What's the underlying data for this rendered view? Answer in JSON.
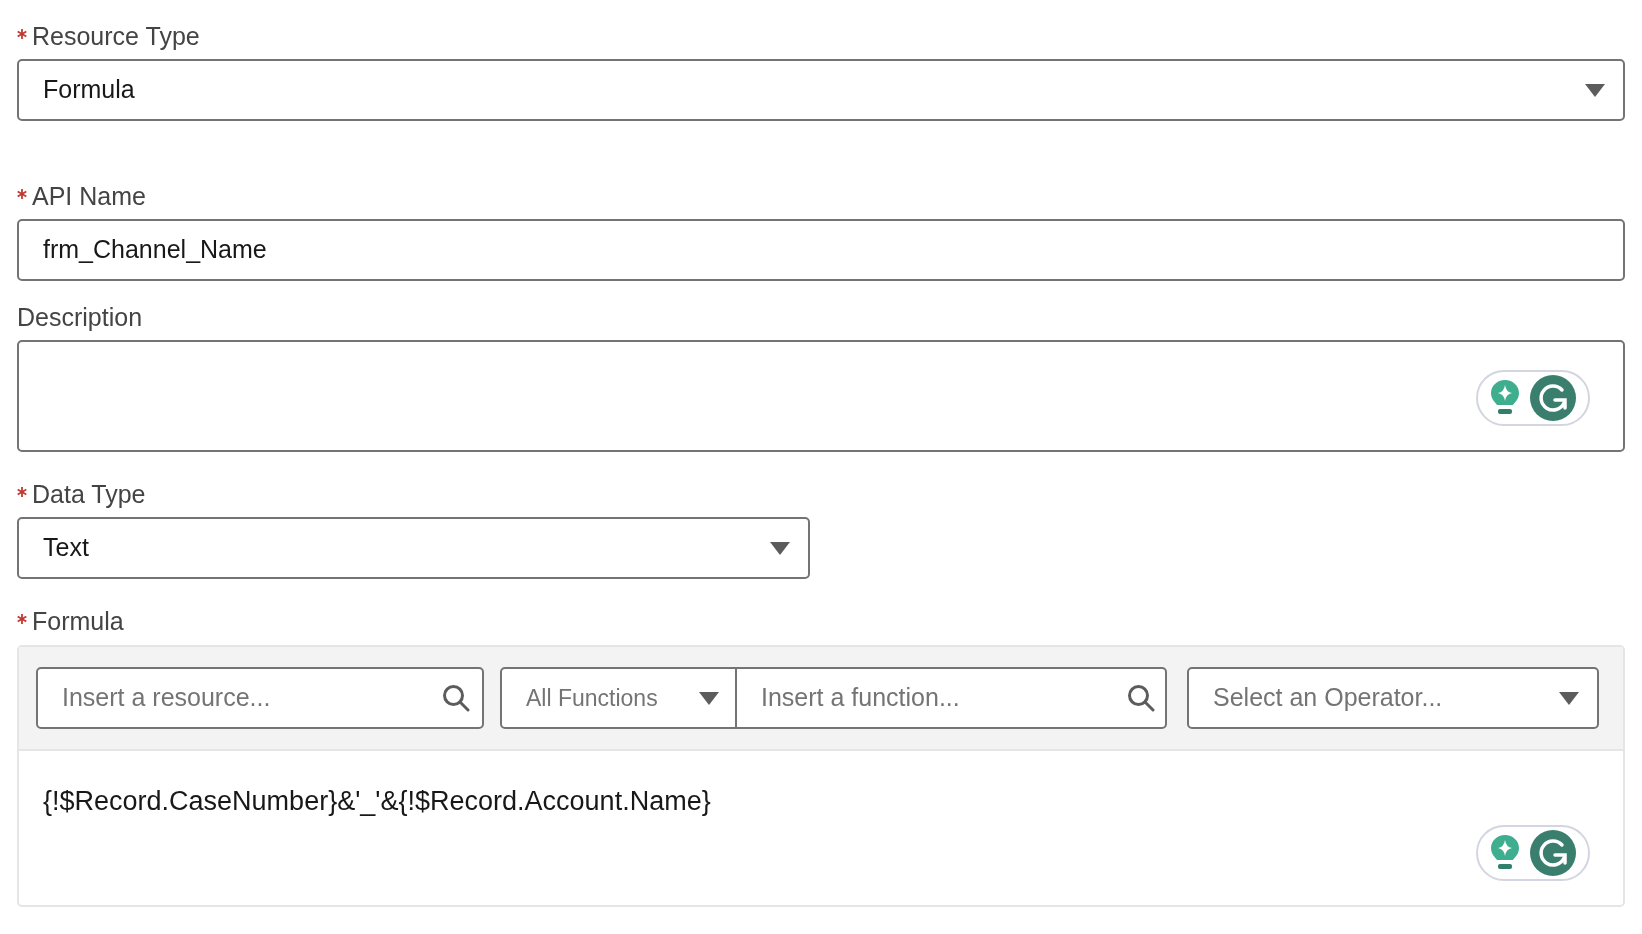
{
  "fields": [
    {
      "kind": "select",
      "label": "Resource Type",
      "required": true,
      "value": "Formula"
    },
    {
      "kind": "input",
      "label": "API Name",
      "required": true,
      "value": "frm_Channel_Name"
    },
    {
      "kind": "textarea",
      "label": "Description",
      "required": false
    },
    {
      "kind": "select",
      "label": "Data Type",
      "required": true,
      "value": "Text"
    }
  ],
  "formula": {
    "label": "Formula",
    "required": true,
    "resource_search": {
      "placeholder": "Insert a resource..."
    },
    "function_category": "All Functions",
    "function_search": {
      "placeholder": "Insert a function..."
    },
    "operator_select": {
      "placeholder": "Select an Operator..."
    },
    "value": "{!$Record.CaseNumber}&'_'&{!$Record.Account.Name}"
  }
}
